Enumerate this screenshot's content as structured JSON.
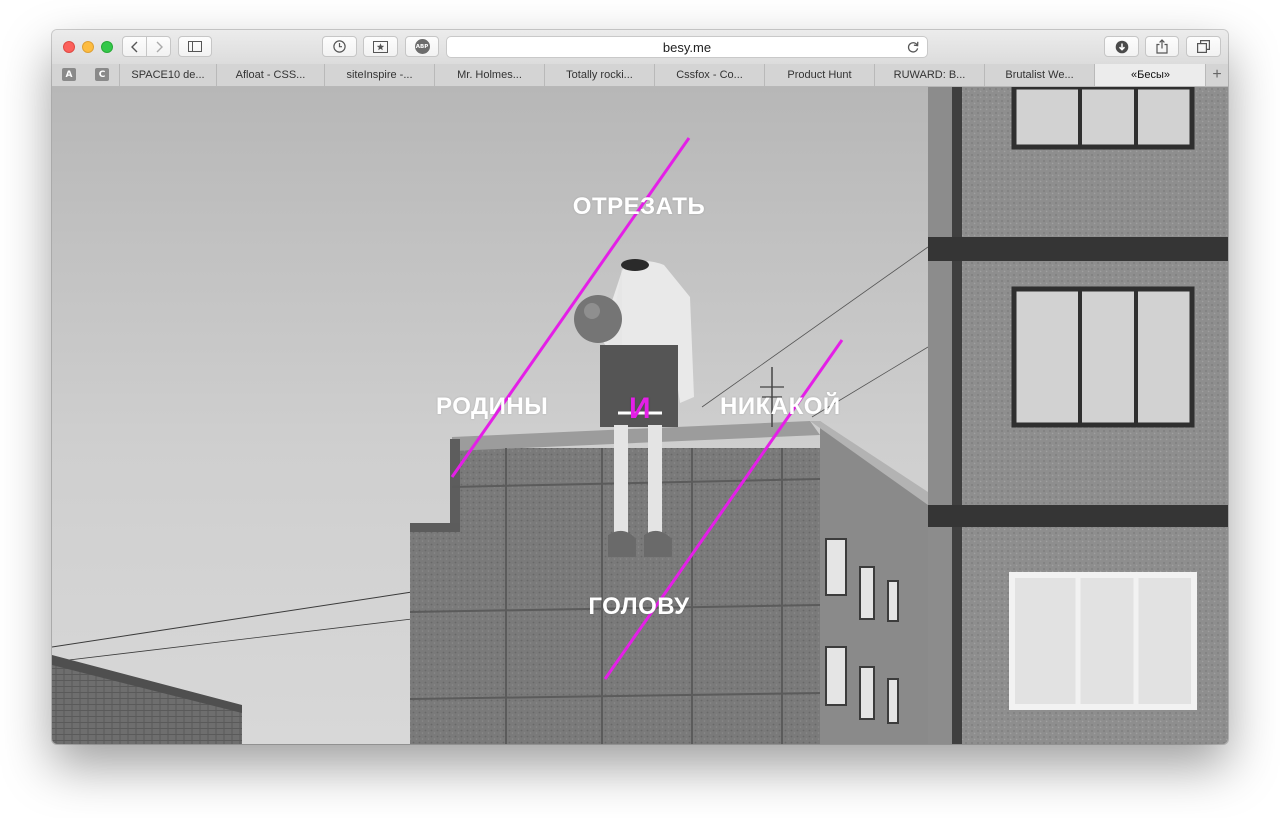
{
  "browser": {
    "url": "besy.me",
    "pinned_tabs": [
      "A",
      "C"
    ],
    "tabs": [
      {
        "label": "SPACE10 de..."
      },
      {
        "label": "Afloat - CSS..."
      },
      {
        "label": "siteInspire -..."
      },
      {
        "label": "Mr. Holmes..."
      },
      {
        "label": "Totally rocki..."
      },
      {
        "label": "Cssfox - Co..."
      },
      {
        "label": "Product Hunt"
      },
      {
        "label": "RUWARD: B..."
      },
      {
        "label": "Brutalist We..."
      },
      {
        "label": "«Бесы»",
        "active": true
      }
    ],
    "new_tab": "+",
    "adblock_label": "ABP"
  },
  "page": {
    "words": {
      "top": "ОТРЕЗАТЬ",
      "left": "РОДИНЫ",
      "middle": "И",
      "right": "НИКАКОЙ",
      "bottom": "ГОЛОВУ"
    },
    "accent_color": "#e41fe7"
  }
}
